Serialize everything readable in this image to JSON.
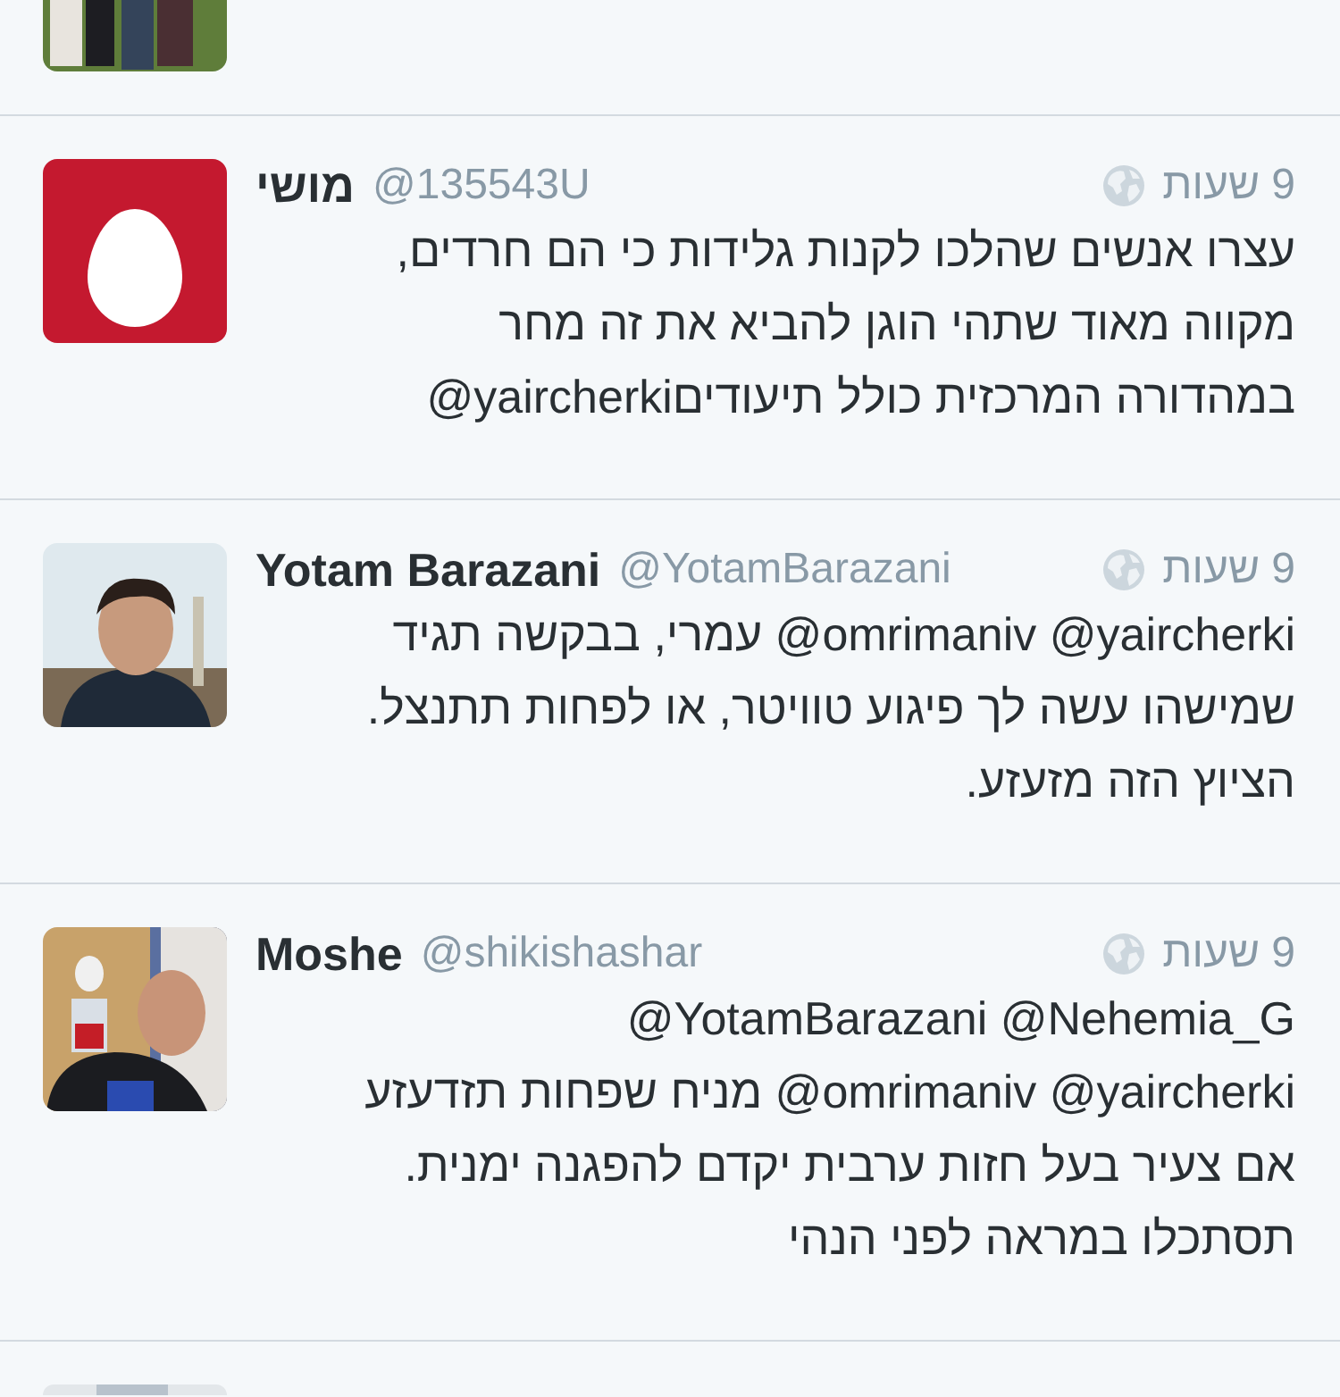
{
  "tweets": [
    {
      "kind": "cut_top",
      "avatar": {
        "kind": "picture"
      }
    },
    {
      "kind": "full",
      "avatar": {
        "kind": "egg"
      },
      "name": "מושי",
      "handle": "@135543U",
      "time": "9 שעות",
      "lines": [
        "עצרו אנשים שהלכו לקנות גלידות כי הם חרדים,",
        "מקווה מאוד שתהי הוגן להביא את זה מחר",
        "במהדורה המרכזית כולל תיעודים@yaircherki"
      ]
    },
    {
      "kind": "full",
      "avatar": {
        "kind": "picture"
      },
      "name": "Yotam Barazani",
      "handle": "@YotamBarazani",
      "time": "9 שעות",
      "lines": [
        "@yaircherki @omrimaniv עמרי, בבקשה תגיד",
        "שמישהו עשה לך פיגוע טוויטר, או לפחות תתנצל.",
        "הציוץ הזה מזעזע."
      ]
    },
    {
      "kind": "full",
      "avatar": {
        "kind": "picture"
      },
      "name": "Moshe",
      "handle": "@shikishashar",
      "time": "9 שעות",
      "lines": [
        "@Nehemia_G @YotamBarazani",
        "@yaircherki @omrimaniv מניח שפחות תזדעזע",
        "אם צעיר בעל חזות ערבית יקדם להפגנה ימנית.",
        "תסתכלו במראה לפני הנהי"
      ]
    },
    {
      "kind": "cut_bottom",
      "avatar": {
        "kind": "picture"
      }
    }
  ]
}
